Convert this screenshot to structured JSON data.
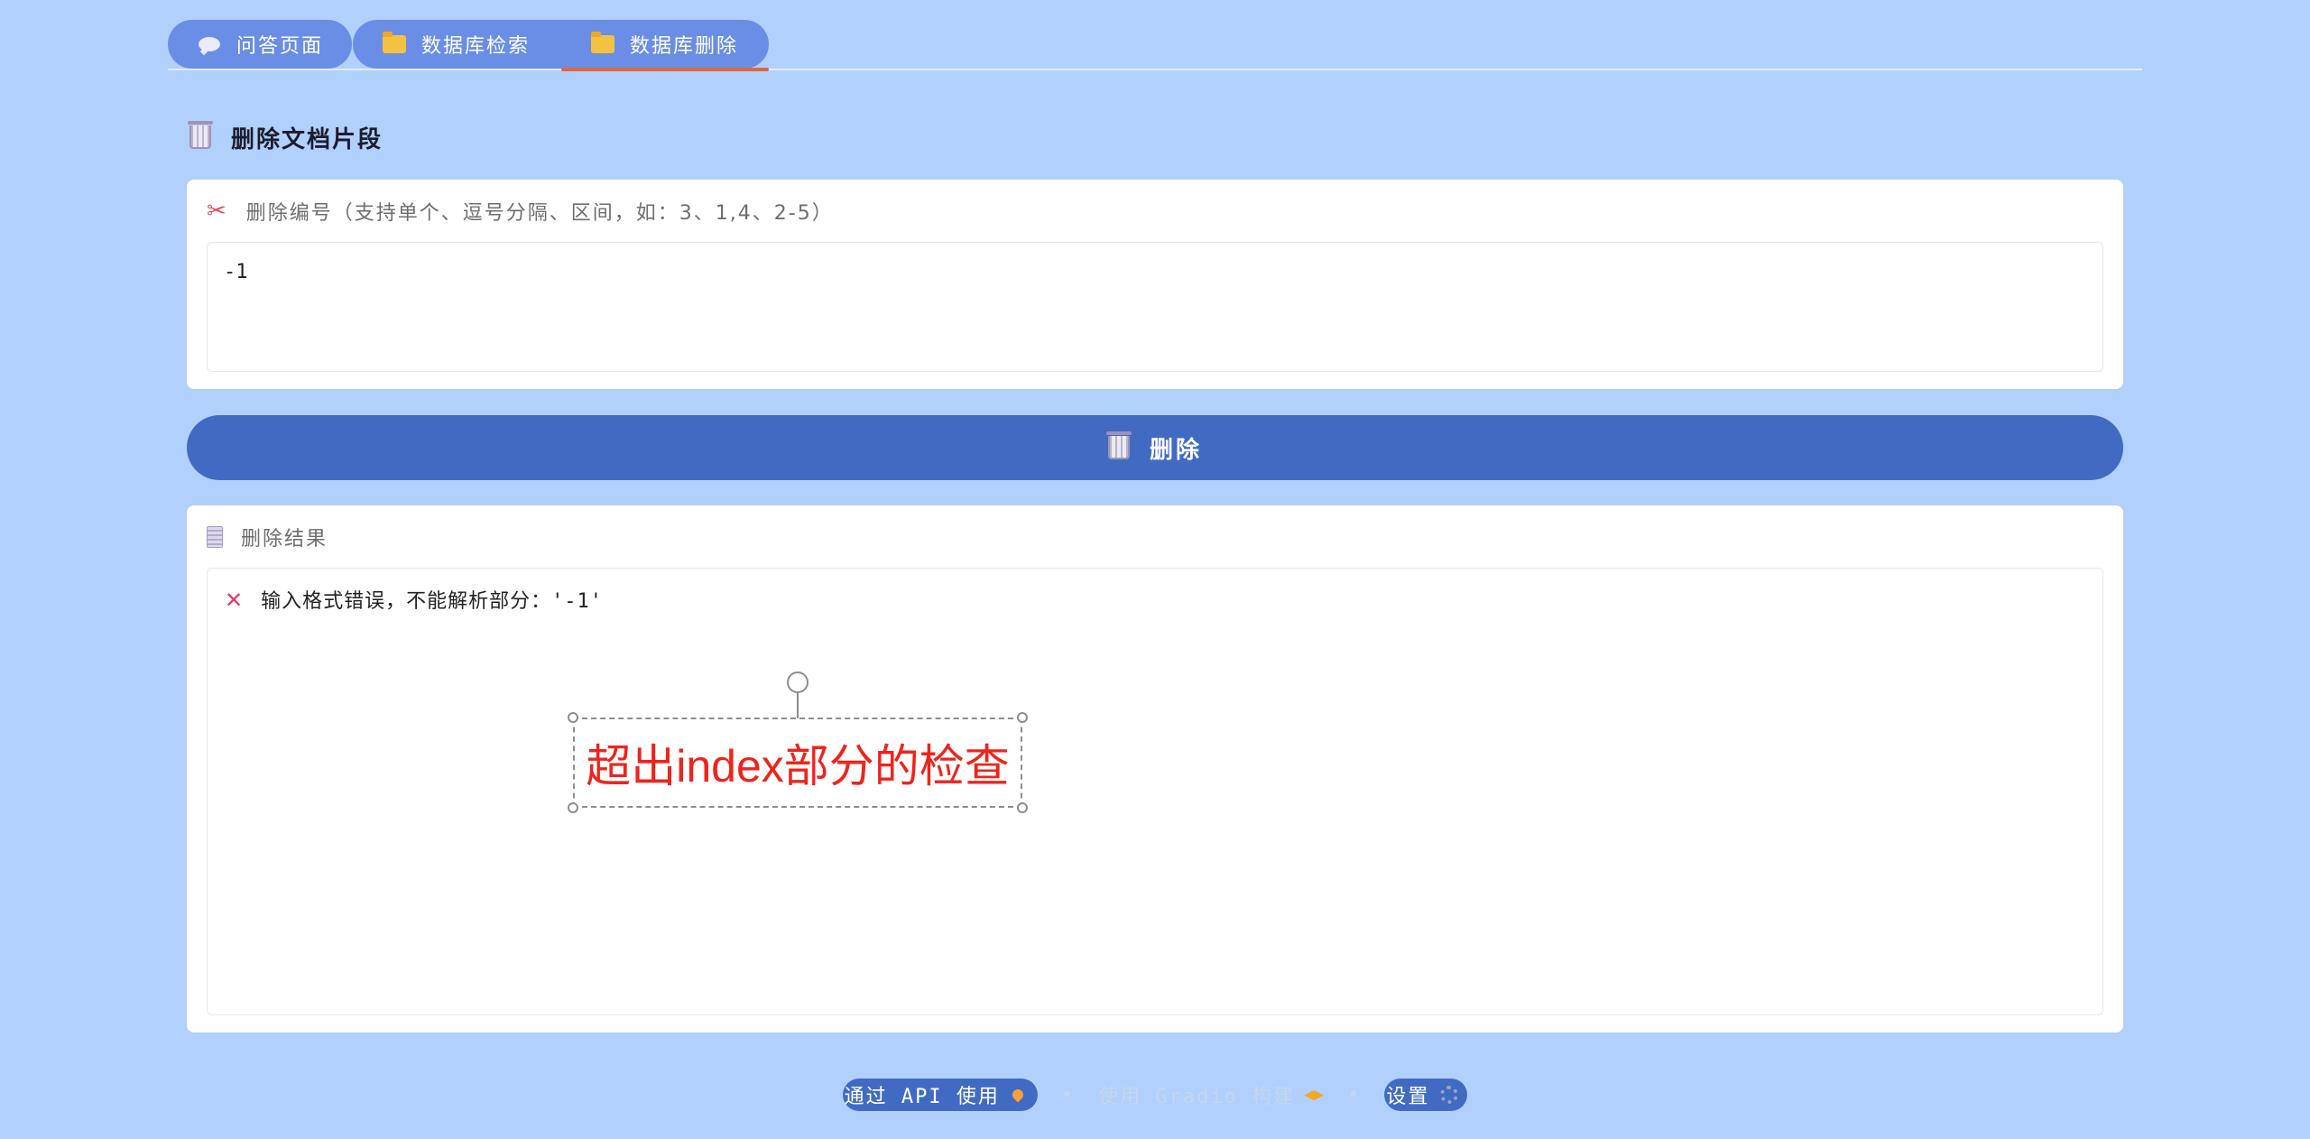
{
  "tabs": [
    {
      "label": "问答页面",
      "icon": "speech-bubble-icon",
      "active": false
    },
    {
      "label": "数据库检索",
      "icon": "folder-icon",
      "active": false
    },
    {
      "label": "数据库删除",
      "icon": "folder-icon",
      "active": true
    }
  ],
  "section": {
    "title": "删除文档片段",
    "icon": "trash-icon"
  },
  "delete_input": {
    "label": "删除编号（支持单个、逗号分隔、区间，如：3、1,4、2-5）",
    "icon": "scissors-icon",
    "value": "-1"
  },
  "delete_button": {
    "label": "删除",
    "icon": "trash-icon"
  },
  "result": {
    "label": "删除结果",
    "icon": "document-icon",
    "message": "输入格式错误，不能解析部分：'-1'",
    "message_icon": "cross-icon"
  },
  "annotation": {
    "text": "超出index部分的检查",
    "color": "#f0231c"
  },
  "footer": {
    "api_label": "通过 API 使用",
    "built_with": "使用 Gradio 构建",
    "settings_label": "设置",
    "separator": "•"
  },
  "colors": {
    "background": "#b1d0fc",
    "primary_button": "#416bc3",
    "tab": "#6a8ee6",
    "active_tab_indicator": "#e6643a"
  }
}
